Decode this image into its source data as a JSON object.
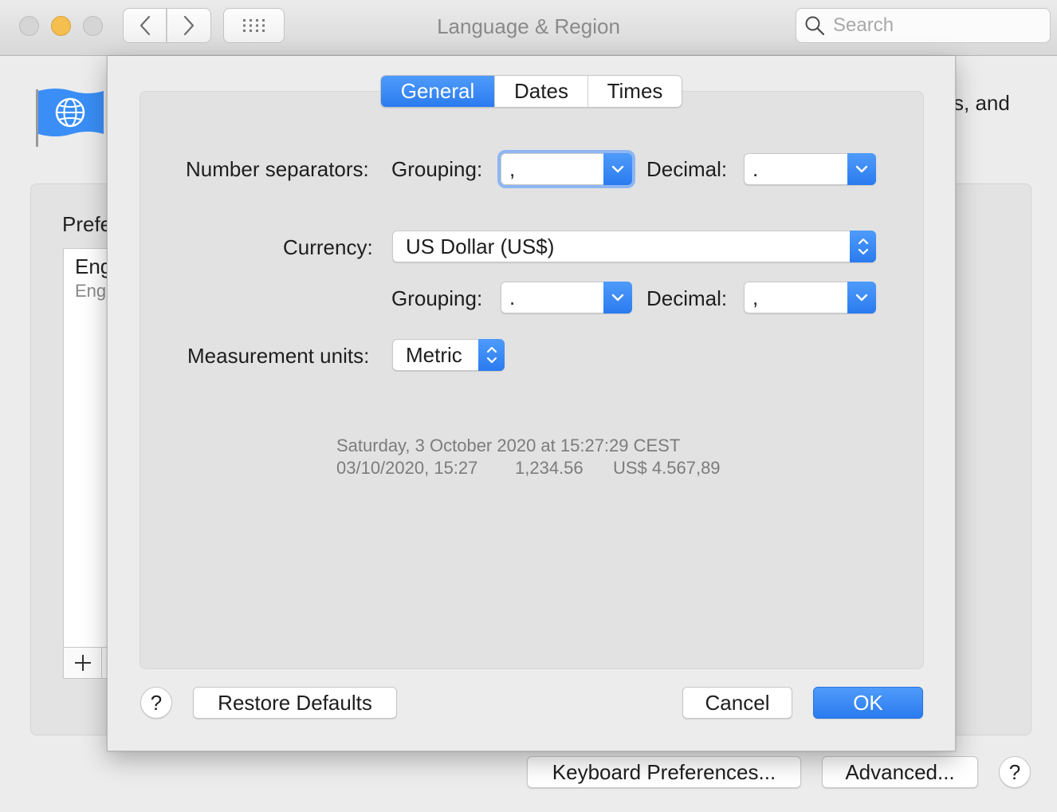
{
  "window": {
    "title": "Language & Region",
    "search_placeholder": "Search"
  },
  "background": {
    "description_fragment": "s, and",
    "preferred_label_fragment": "Prefe",
    "list_item_main": "Eng",
    "list_item_sub": "Eng",
    "keyboard_button": "Keyboard Preferences...",
    "advanced_button": "Advanced...",
    "help_label": "?"
  },
  "sheet": {
    "tabs": [
      {
        "label": "General",
        "active": true
      },
      {
        "label": "Dates",
        "active": false
      },
      {
        "label": "Times",
        "active": false
      }
    ],
    "number_separators_label": "Number separators:",
    "number_grouping_label": "Grouping:",
    "number_grouping_value": ",",
    "number_decimal_label": "Decimal:",
    "number_decimal_value": ".",
    "currency_label": "Currency:",
    "currency_value": "US Dollar (US$)",
    "currency_grouping_label": "Grouping:",
    "currency_grouping_value": ".",
    "currency_decimal_label": "Decimal:",
    "currency_decimal_value": ",",
    "measurement_label": "Measurement units:",
    "measurement_value": "Metric",
    "sample_line1": "Saturday, 3 October 2020 at 15:27:29 CEST",
    "sample_date": "03/10/2020, 15:27",
    "sample_number": "1,234.56",
    "sample_currency": "US$ 4.567,89",
    "help_label": "?",
    "restore_button": "Restore Defaults",
    "cancel_button": "Cancel",
    "ok_button": "OK"
  },
  "colors": {
    "accent": "#2f80f0",
    "close_button": "#d5d5d5",
    "minimize_button": "#f4bf4f"
  }
}
